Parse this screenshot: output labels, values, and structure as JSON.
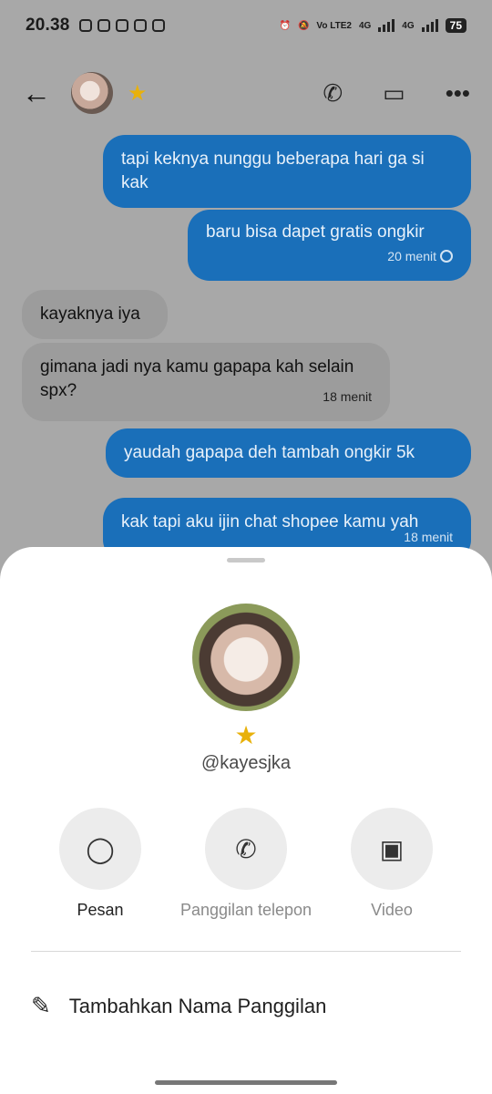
{
  "status_bar": {
    "time": "20.38",
    "network1": "4G",
    "network_label": "Vo LTE2",
    "network2": "4G",
    "battery": "75"
  },
  "header": {
    "back_icon": "back-arrow-icon",
    "call_icon": "phone-icon",
    "video_icon": "video-camera-icon",
    "more_icon": "more-dots-icon"
  },
  "messages": [
    {
      "text": "tapi keknya nunggu beberapa hari ga si kak",
      "direction": "out",
      "time": ""
    },
    {
      "text": "baru bisa dapet gratis ongkir",
      "direction": "out",
      "time": "20 menit"
    },
    {
      "text": "kayaknya iya",
      "direction": "in",
      "time": ""
    },
    {
      "text": "gimana jadi nya kamu gapapa kah selain spx?",
      "direction": "in",
      "time": "18 menit"
    },
    {
      "text": "yaudah gapapa deh tambah ongkir 5k",
      "direction": "out",
      "time": ""
    },
    {
      "text": "kak tapi aku ijin chat shopee kamu yah",
      "direction": "out",
      "time": "18 menit"
    }
  ],
  "profile_sheet": {
    "username": "@kayesjka",
    "actions": [
      {
        "label": "Pesan",
        "icon": "message-icon"
      },
      {
        "label": "Panggilan telepon",
        "icon": "phone-icon"
      },
      {
        "label": "Video",
        "icon": "video-camera-icon"
      }
    ],
    "add_nickname_label": "Tambahkan Nama Panggilan"
  },
  "colors": {
    "outgoing_bubble": "#1a6fb9",
    "incoming_bubble": "#9c9c9c",
    "star": "#e8b10b"
  }
}
